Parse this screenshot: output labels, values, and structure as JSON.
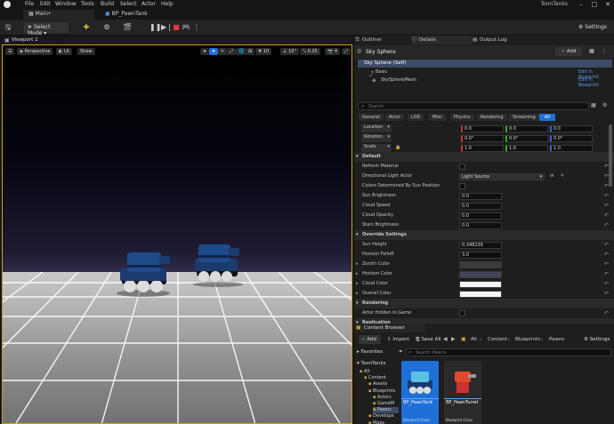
{
  "menubar": {
    "items": [
      "File",
      "Edit",
      "Window",
      "Tools",
      "Build",
      "Select",
      "Actor",
      "Help"
    ],
    "project": "ToonTanks"
  },
  "doctabs": [
    {
      "label": "Main•"
    },
    {
      "label": "BP_PawnTank"
    }
  ],
  "toolbar": {
    "select_mode": "Select Mode",
    "settings": "Settings"
  },
  "viewport": {
    "tab": "Viewport 1",
    "perspective": "Perspective",
    "lit": "Lit",
    "show": "Show",
    "grid_size": "10",
    "rotation": "10°",
    "scale": "0.25",
    "camera_speed": "4"
  },
  "right_tabs": [
    "Outliner",
    "Details",
    "Output Log"
  ],
  "details": {
    "actor_name": "Sky Sphere",
    "add": "Add",
    "self": "Sky Sphere (Self)",
    "basic": "Basic",
    "mesh": "SkySphereMesh",
    "edit_blueprint": "Edit in Blueprint",
    "search_placeholder": "Search",
    "filters": [
      "General",
      "Actor",
      "LOD",
      "Misc",
      "Physics",
      "Rendering",
      "Streaming",
      "All"
    ],
    "transform": [
      {
        "label": "Location",
        "x": "0.0",
        "y": "0.0",
        "z": "0.0"
      },
      {
        "label": "Rotation",
        "x": "0.0°",
        "y": "0.0°",
        "z": "0.0°"
      },
      {
        "label": "Scale",
        "x": "1.0",
        "y": "1.0",
        "z": "1.0"
      }
    ],
    "default_section": "Default",
    "default_rows": [
      {
        "label": "Refresh Material",
        "kind": "check"
      },
      {
        "label": "Directional Light Actor",
        "kind": "select",
        "value": "Light Source"
      },
      {
        "label": "Colors Determined By Sun Position",
        "kind": "check"
      },
      {
        "label": "Sun Brightness",
        "kind": "num",
        "value": "0.0"
      },
      {
        "label": "Cloud Speed",
        "kind": "num",
        "value": "0.0"
      },
      {
        "label": "Cloud Opacity",
        "kind": "num",
        "value": "0.0"
      },
      {
        "label": "Stars Brightness",
        "kind": "num",
        "value": "0.0"
      }
    ],
    "override_section": "Override Settings",
    "override_rows": [
      {
        "label": "Sun Height",
        "kind": "num",
        "value": "0.348239"
      },
      {
        "label": "Horizon Falloff",
        "kind": "num",
        "value": "3.0"
      },
      {
        "label": "Zenith Color",
        "kind": "color",
        "color": "#3b3b3b"
      },
      {
        "label": "Horizon Color",
        "kind": "color",
        "color": "#43435a"
      },
      {
        "label": "Cloud Color",
        "kind": "color",
        "color": "#f2f2f2"
      },
      {
        "label": "Overall Color",
        "kind": "color",
        "color": "#f5f5f5"
      }
    ],
    "rendering_section": "Rendering",
    "rendering_rows": [
      {
        "label": "Actor Hidden In Game",
        "kind": "check"
      }
    ],
    "replication_section": "Replication"
  },
  "content_browser": {
    "tab": "Content Browser",
    "add": "Add",
    "import": "Import",
    "save_all": "Save All",
    "path": [
      "All",
      "Content",
      "Blueprints",
      "Pawns"
    ],
    "settings": "Settings",
    "favorites": "Favorites",
    "search_placeholder": "Search Pawns",
    "root": "ToonTanks",
    "tree": [
      {
        "label": "All",
        "depth": 0
      },
      {
        "label": "Content",
        "depth": 1
      },
      {
        "label": "Assets",
        "depth": 2
      },
      {
        "label": "Blueprints",
        "depth": 2
      },
      {
        "label": "Actors",
        "depth": 3
      },
      {
        "label": "GameM",
        "depth": 3
      },
      {
        "label": "Pawns",
        "depth": 3
      },
      {
        "label": "Develope",
        "depth": 2
      },
      {
        "label": "Maps",
        "depth": 2
      }
    ],
    "assets": [
      {
        "name": "BP_PawnTank",
        "type": "Blueprint Class",
        "selected": true
      },
      {
        "name": "BP_PawnTurret",
        "type": "Blueprint Class",
        "selected": false
      }
    ]
  }
}
